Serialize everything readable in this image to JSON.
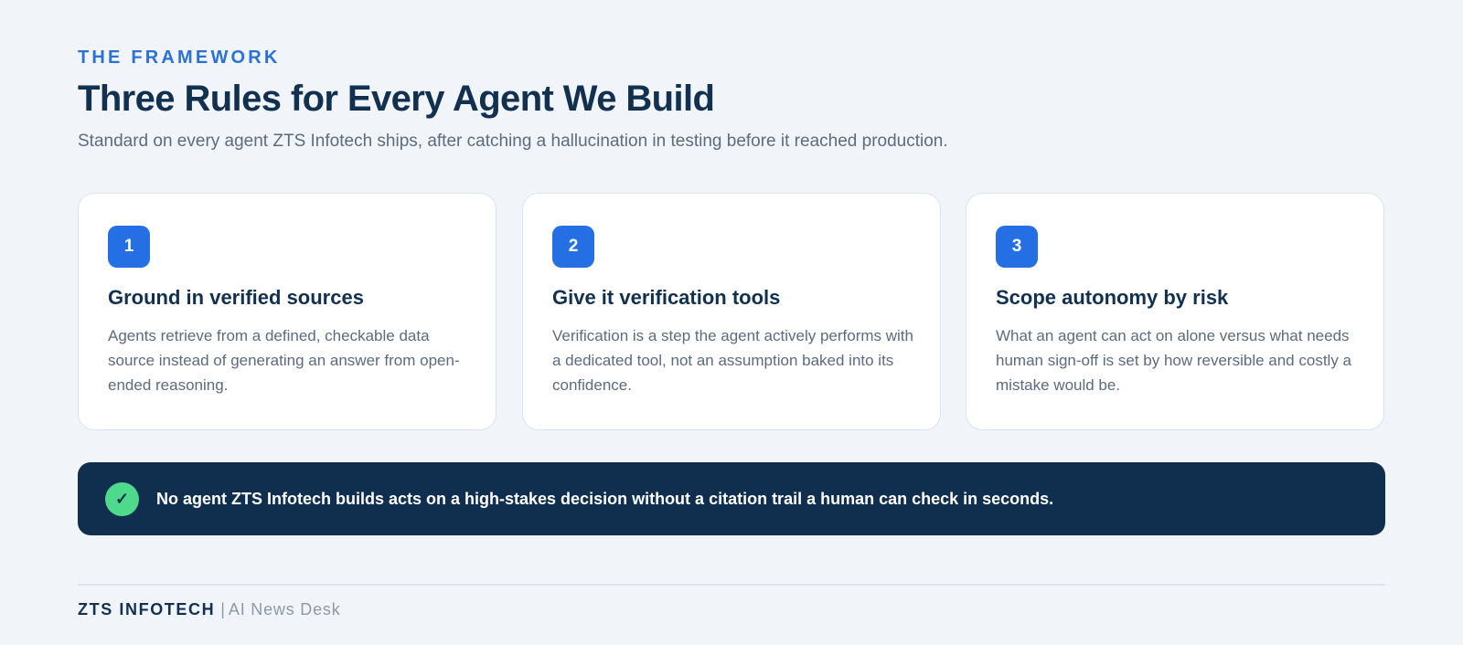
{
  "header": {
    "eyebrow": "THE FRAMEWORK",
    "title": "Three Rules for Every Agent We Build",
    "subtitle": "Standard on every agent ZTS Infotech ships, after catching a hallucination in testing before it reached production."
  },
  "cards": [
    {
      "number": "1",
      "title": "Ground in verified sources",
      "body": "Agents retrieve from a defined, checkable data source instead of generating an answer from open-ended reasoning."
    },
    {
      "number": "2",
      "title": "Give it verification tools",
      "body": "Verification is a step the agent actively performs with a dedicated tool, not an assumption baked into its confidence."
    },
    {
      "number": "3",
      "title": "Scope autonomy by risk",
      "body": "What an agent can act on alone versus what needs human sign-off is set by how reversible and costly a mistake would be."
    }
  ],
  "banner": {
    "icon": "check-icon",
    "icon_glyph": "✓",
    "text": "No agent ZTS Infotech builds acts on a high-stakes decision without a citation trail a human can check in seconds."
  },
  "footer": {
    "brand": "ZTS INFOTECH",
    "separator": "|",
    "desk": "AI News Desk"
  },
  "colors": {
    "accent": "#246fe3",
    "navy": "#102e4e",
    "check": "#4fd98c",
    "background": "#f1f5fa"
  }
}
